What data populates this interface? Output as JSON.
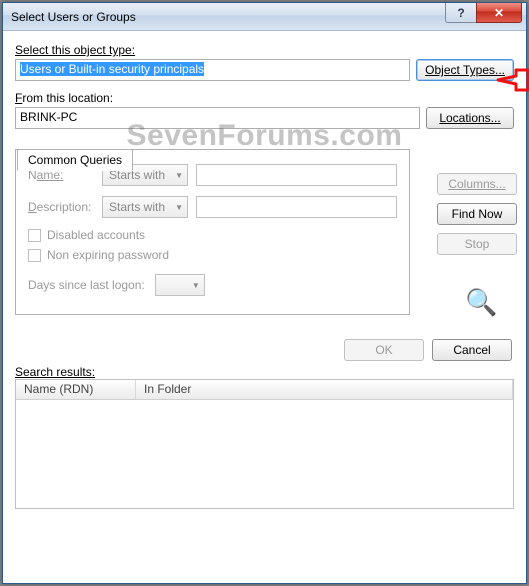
{
  "window": {
    "title": "Select Users or Groups",
    "help": "?",
    "close": "✕"
  },
  "object_type": {
    "label": "Select this object type:",
    "value": "Users or Built-in security principals",
    "button": "Object Types..."
  },
  "location": {
    "label_pre": "F",
    "label_post": "rom this location:",
    "value": "BRINK-PC",
    "button": "Locations..."
  },
  "tab": {
    "label": "Common Queries"
  },
  "queries": {
    "name_label_u": "N",
    "name_label": "ame:",
    "name_mode": "Starts with",
    "desc_label_u": "D",
    "desc_label": "escription:",
    "desc_mode": "Starts with",
    "disabled_accounts": "Disabled accounts",
    "non_expiring": "Non expiring password",
    "days_label": "Days since last logon:"
  },
  "side": {
    "columns": "Columns...",
    "find_now": "Find Now",
    "stop": "Stop"
  },
  "footer": {
    "ok": "OK",
    "cancel": "Cancel"
  },
  "results": {
    "label": "Search results:",
    "col1": "Name (RDN)",
    "col2": "In Folder"
  },
  "watermark": "SevenForums.com"
}
